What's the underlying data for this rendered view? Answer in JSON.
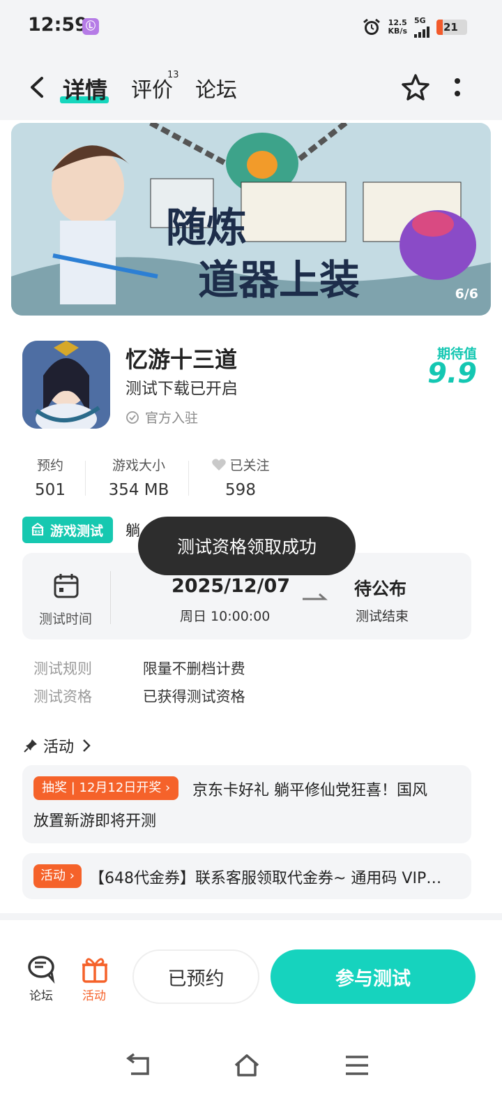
{
  "status_bar": {
    "time": "12:59",
    "app_icon": "Ⓛ",
    "net_speed": "12.5",
    "net_unit": "KB/s",
    "network": "5G",
    "battery": "21"
  },
  "nav": {
    "tabs": [
      {
        "label": "详情",
        "active": true
      },
      {
        "label": "评价",
        "count": "13"
      },
      {
        "label": "论坛"
      }
    ]
  },
  "banner": {
    "counter": "6/6"
  },
  "app": {
    "title": "忆游十三道",
    "subtitle": "测试下载已开启",
    "official_label": "官方入驻",
    "expectation_label": "期待值",
    "expectation_value": "9.9"
  },
  "stats": [
    {
      "label": "预约",
      "value": "501"
    },
    {
      "label": "游戏大小",
      "value": "354 MB"
    },
    {
      "label": "已关注",
      "value": "598"
    }
  ],
  "test": {
    "tag_label": "游戏测试",
    "tag_peek": "躺",
    "time_label": "测试时间",
    "start_date": "2025/12/07",
    "start_detail": "周日  10:00:00",
    "end_value": "待公布",
    "end_label": "测试结束"
  },
  "rules": [
    {
      "label": "测试规则",
      "value": "限量不删档计费"
    },
    {
      "label": "测试资格",
      "value": "已获得测试资格"
    }
  ],
  "toast": "测试资格领取成功",
  "activities": {
    "heading": "活动",
    "items": [
      {
        "tag": "抽奖 | 12月12日开奖 ›",
        "text_line1": "京东卡好礼 躺平修仙党狂喜！国风",
        "text_line2": "放置新游即将开测"
      },
      {
        "tag": "活动 ›",
        "text": "【648代金券】联系客服领取代金券~ 通用码 VIP…"
      }
    ]
  },
  "bottom_bar": {
    "forum_label": "论坛",
    "activity_label": "活动",
    "reserved_label": "已预约",
    "join_label": "参与测试"
  },
  "colors": {
    "accent": "#16d3be",
    "orange": "#f5622a",
    "toast_bg": "#2d2d2d"
  }
}
